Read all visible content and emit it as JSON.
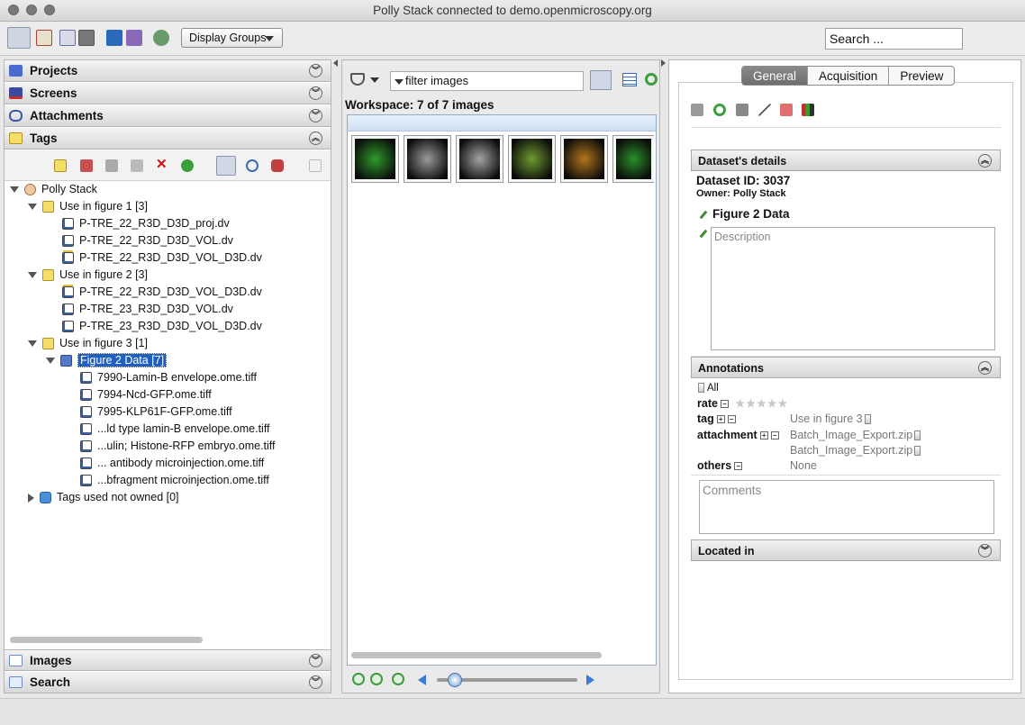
{
  "window": {
    "title": "Polly Stack connected to demo.openmicroscopy.org"
  },
  "toolbar": {
    "display_groups": "Display Groups",
    "search_value": "Search ..."
  },
  "left_sections": {
    "projects": "Projects",
    "screens": "Screens",
    "attachments": "Attachments",
    "tags": "Tags",
    "images": "Images",
    "search": "Search"
  },
  "tree": {
    "root": "Polly Stack",
    "groups": [
      {
        "label": "Use in figure 1 [3]",
        "items": [
          "P-TRE_22_R3D_D3D_proj.dv",
          "P-TRE_22_R3D_D3D_VOL.dv",
          "P-TRE_22_R3D_D3D_VOL_D3D.dv"
        ]
      },
      {
        "label": "Use in figure 2 [3]",
        "items": [
          "P-TRE_22_R3D_D3D_VOL_D3D.dv",
          "P-TRE_23_R3D_D3D_VOL.dv",
          "P-TRE_23_R3D_D3D_VOL_D3D.dv"
        ]
      },
      {
        "label": "Use in figure 3 [1]"
      }
    ],
    "dataset": "Figure 2 Data [7]",
    "dataset_items": [
      "7990-Lamin-B envelope.ome.tiff",
      "7994-Ncd-GFP.ome.tiff",
      "7995-KLP61F-GFP.ome.tiff",
      "...ld type lamin-B envelope.ome.tiff",
      "...ulin; Histone-RFP embryo.ome.tiff",
      "... antibody microinjection.ome.tiff",
      "...bfragment microinjection.ome.tiff"
    ],
    "not_owned": "Tags used not owned [0]"
  },
  "middle": {
    "filter_text": "filter  images",
    "workspace": "Workspace: 7 of 7 images",
    "thumb_colors": [
      "#2f9a2a",
      "#9a9a9a",
      "#a4a4a4",
      "#6f9a30",
      "#b2761c",
      "#2a8f28"
    ],
    "zoom_fraction": 0.13
  },
  "right": {
    "tabs": [
      "General",
      "Acquisition",
      "Preview"
    ],
    "details_header": "Dataset's details",
    "dataset_id": "Dataset ID: 3037",
    "owner": "Owner: Polly Stack",
    "name": "Figure 2 Data",
    "description_placeholder": "Description",
    "annotations_header": "Annotations",
    "all_label": "All",
    "rate_label": "rate",
    "tag_label": "tag",
    "tag_value": "Use in figure 3",
    "attachment_label": "attachment",
    "attachments": [
      "Batch_Image_Export.zip",
      "Batch_Image_Export.zip"
    ],
    "others_label": "others",
    "others_value": "None",
    "comments_placeholder": "Comments",
    "located_header": "Located in"
  }
}
